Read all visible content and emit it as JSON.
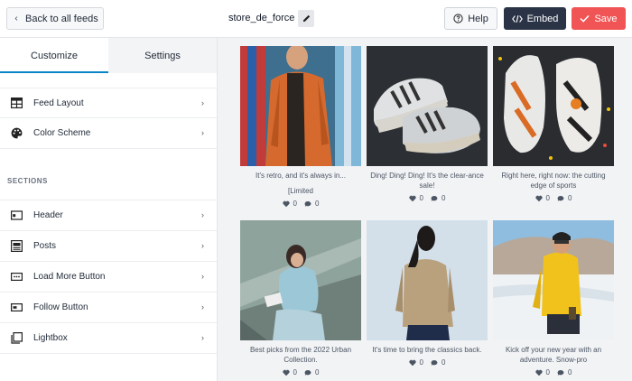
{
  "topbar": {
    "back_label": "Back to all feeds",
    "feed_name": "store_de_force",
    "help_label": "Help",
    "embed_label": "Embed",
    "save_label": "Save"
  },
  "sidebar": {
    "tabs": [
      {
        "label": "Customize",
        "active": true
      },
      {
        "label": "Settings",
        "active": false
      }
    ],
    "items": [
      {
        "label": "Feed Layout"
      },
      {
        "label": "Color Scheme"
      }
    ],
    "sections_label": "SECTIONS",
    "section_items": [
      {
        "label": "Header"
      },
      {
        "label": "Posts"
      },
      {
        "label": "Load More Button"
      },
      {
        "label": "Follow Button"
      },
      {
        "label": "Lightbox"
      }
    ]
  },
  "posts": [
    {
      "caption": "It's retro, and it's always in...",
      "caption2": "[Limited",
      "likes": "0",
      "comments": "0"
    },
    {
      "caption": "Ding! Ding! Ding! It's the clear-ance sale!",
      "caption2": "",
      "likes": "0",
      "comments": "0"
    },
    {
      "caption": "Right here, right now: the cutting edge of sports",
      "caption2": "",
      "likes": "0",
      "comments": "0"
    },
    {
      "caption": "Best picks from the 2022 Urban Collection.",
      "caption2": "",
      "likes": "0",
      "comments": "0"
    },
    {
      "caption": "It's time to bring the classics back.",
      "caption2": "",
      "likes": "0",
      "comments": "0"
    },
    {
      "caption": "Kick off your new year with an adventure. Snow-pro",
      "caption2": "",
      "likes": "0",
      "comments": "0"
    }
  ],
  "colors": {
    "accent": "#0a84c6",
    "save": "#f05454",
    "embed": "#2b3447"
  }
}
